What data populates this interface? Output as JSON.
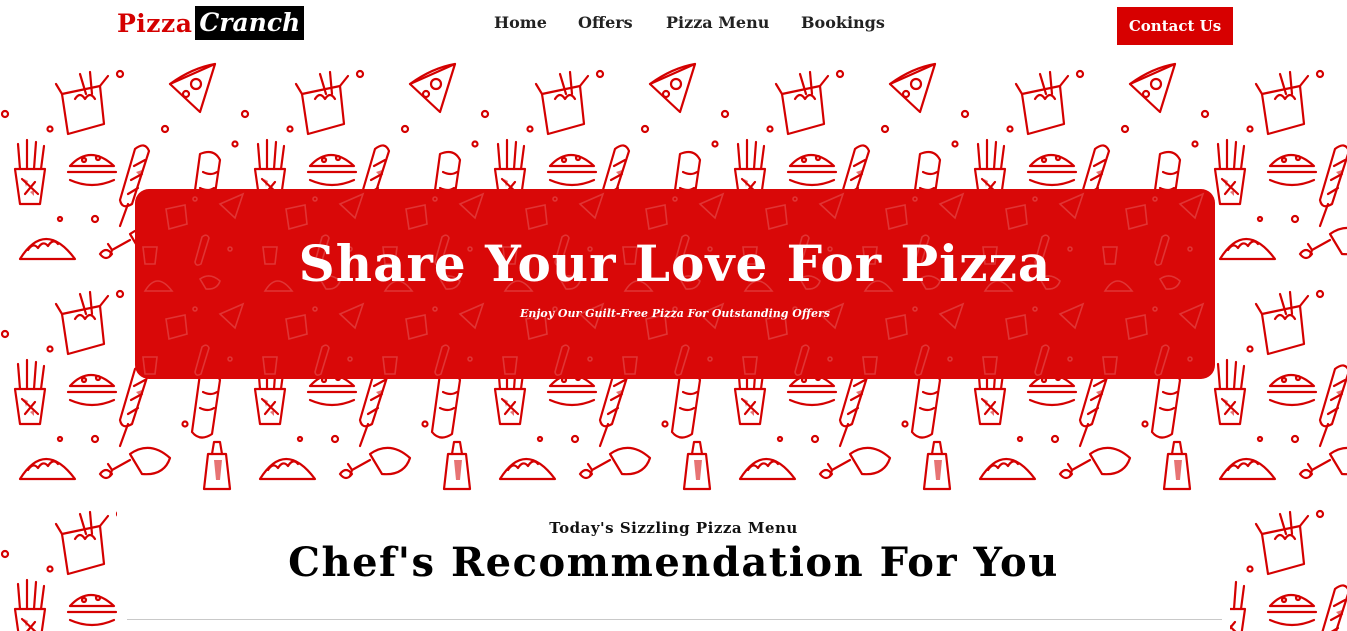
{
  "brand": {
    "name_part1": "Pizza",
    "name_part2": "Cranch"
  },
  "nav": {
    "items": [
      "Home",
      "Offers",
      "Pizza Menu",
      "Bookings"
    ]
  },
  "header": {
    "contact_label": "Contact Us"
  },
  "hero": {
    "title": "Share Your Love For Pizza",
    "subtitle": "Enjoy Our Guilt-Free Pizza For Outstanding Offers"
  },
  "menu": {
    "kicker": "Today's Sizzling Pizza Menu",
    "title": "Chef's Recommendation For You"
  },
  "colors": {
    "accent": "#d70000",
    "hero_bg": "#d90808",
    "pattern": "#d40000",
    "text": "#111111"
  },
  "icons": [
    "pizza-slice-icon",
    "noodle-box-icon",
    "fries-icon",
    "sausage-icon",
    "burrito-icon",
    "taco-icon",
    "chicken-leg-icon",
    "burger-icon",
    "sauce-bottle-icon"
  ]
}
